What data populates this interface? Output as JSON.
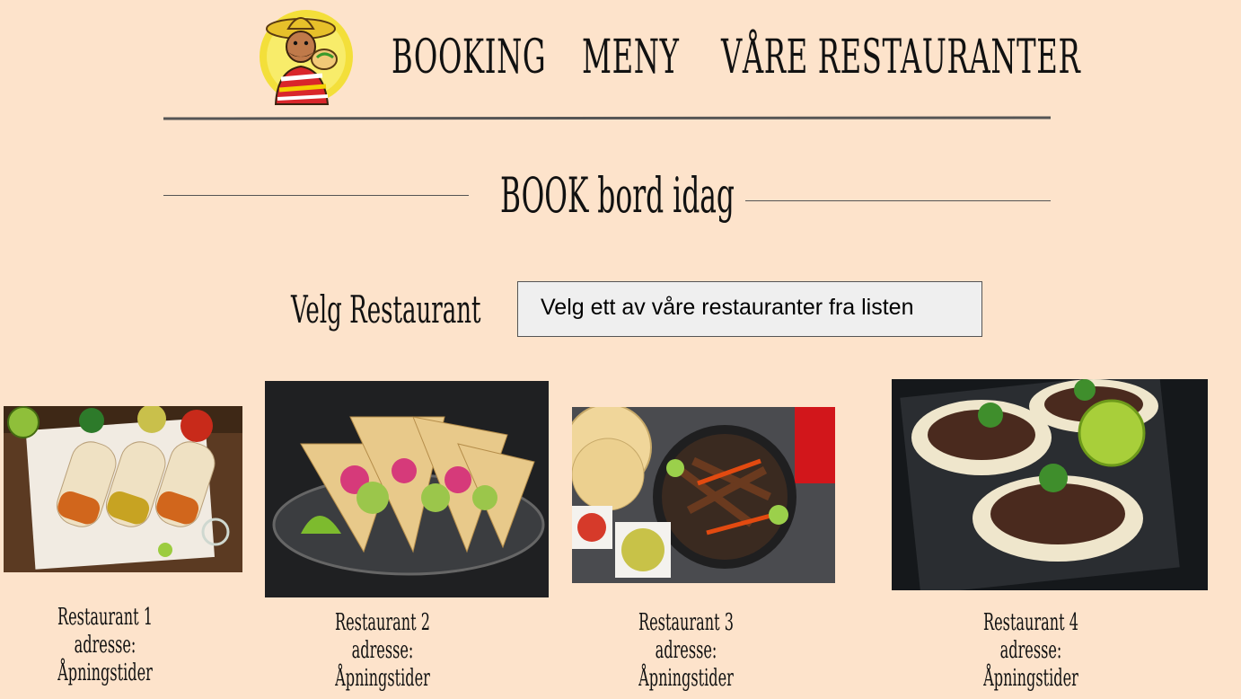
{
  "header": {
    "logo_icon": "taco-mascot-logo",
    "nav": [
      {
        "label": "BOOKING"
      },
      {
        "label": "MENY"
      },
      {
        "label": "VÅRE RESTAURANTER"
      }
    ]
  },
  "section": {
    "title": "BOOK bord idag"
  },
  "picker": {
    "label": "Velg Restaurant",
    "selected": "Velg ett av våre restauranter fra listen"
  },
  "restaurants": [
    {
      "name": "Restaurant 1",
      "address": "adresse:",
      "hours": "Åpningstider",
      "image_icon": "fajita-wraps-photo"
    },
    {
      "name": "Restaurant 2",
      "address": "adresse:",
      "hours": "Åpningstider",
      "image_icon": "tacos-plate-photo"
    },
    {
      "name": "Restaurant 3",
      "address": "adresse:",
      "hours": "Åpningstider",
      "image_icon": "fajita-skillet-photo"
    },
    {
      "name": "Restaurant 4",
      "address": "adresse:",
      "hours": "Åpningstider",
      "image_icon": "birria-tacos-photo"
    }
  ],
  "colors": {
    "background": "#fde3cb",
    "rule": "#555555",
    "select_bg": "#efefef"
  }
}
